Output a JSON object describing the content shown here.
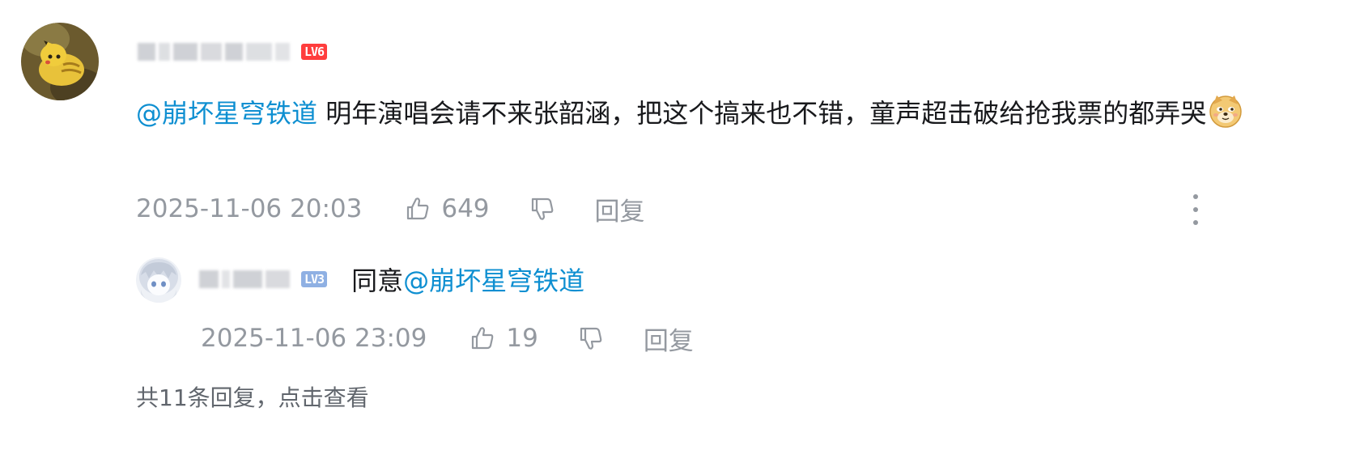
{
  "main_comment": {
    "level": "LV6",
    "mention": "@崩坏星穹铁道",
    "text": " 明年演唱会请不来张韶涵，把这个搞来也不错，童声超击破给抢我票的都弄哭",
    "emoji": "doge-emoji",
    "timestamp": "2025-11-06 20:03",
    "like_count": "649",
    "reply_label": "回复"
  },
  "sub_reply": {
    "level": "LV3",
    "text": "同意",
    "mention": "@崩坏星穹铁道",
    "timestamp": "2025-11-06 23:09",
    "like_count": "19",
    "reply_label": "回复"
  },
  "footer": {
    "total_replies_text": "共11条回复，点击查看"
  },
  "colors": {
    "mention": "#0e8fd1",
    "meta_text": "#9499a0",
    "lv6_badge": "#ff3d3d",
    "lv3_badge": "#8fb0e3"
  }
}
